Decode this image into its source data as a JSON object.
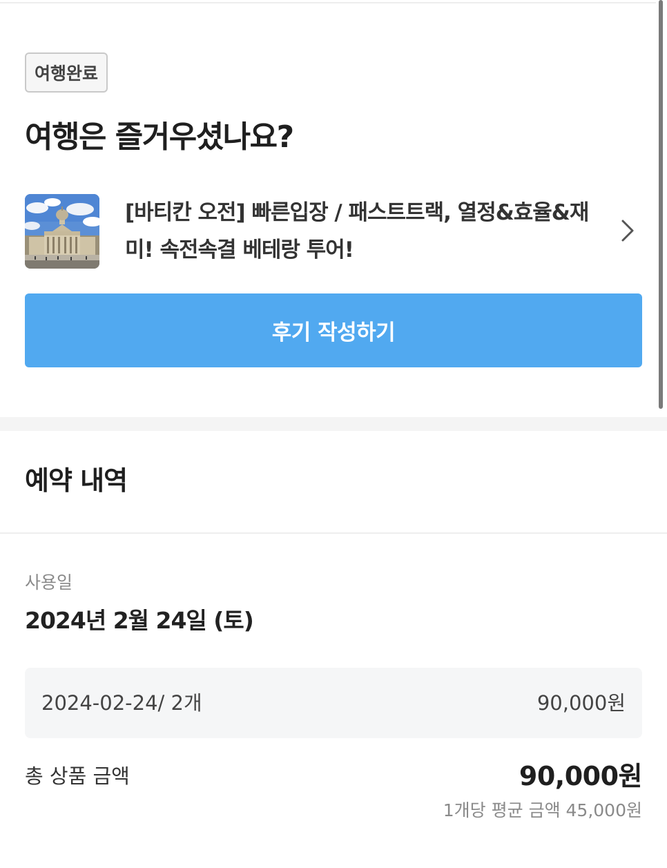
{
  "trip_status": {
    "badge": "여행완료",
    "heading": "여행은 즐거우셨나요?"
  },
  "product": {
    "title": "[바티칸 오전] 빠른입장 / 패스트트랙, 열정&효율&재미! 속전속결 베테랑 투어!",
    "thumbnail_icon": "st-peters-basilica-photo",
    "chevron_icon": "chevron-right-icon"
  },
  "review_button": {
    "label": "후기 작성하기",
    "color": "#51a9f0"
  },
  "reservation": {
    "section_title": "예약 내역",
    "use_date_label": "사용일",
    "use_date": "2024년 2월 24일 (토)",
    "line_item": {
      "description": "2024-02-24/ 2개",
      "price": "90,000원"
    },
    "total_label": "총 상품 금액",
    "total_value": "90,000원",
    "average_note": "1개당 평균 금액 45,000원"
  }
}
